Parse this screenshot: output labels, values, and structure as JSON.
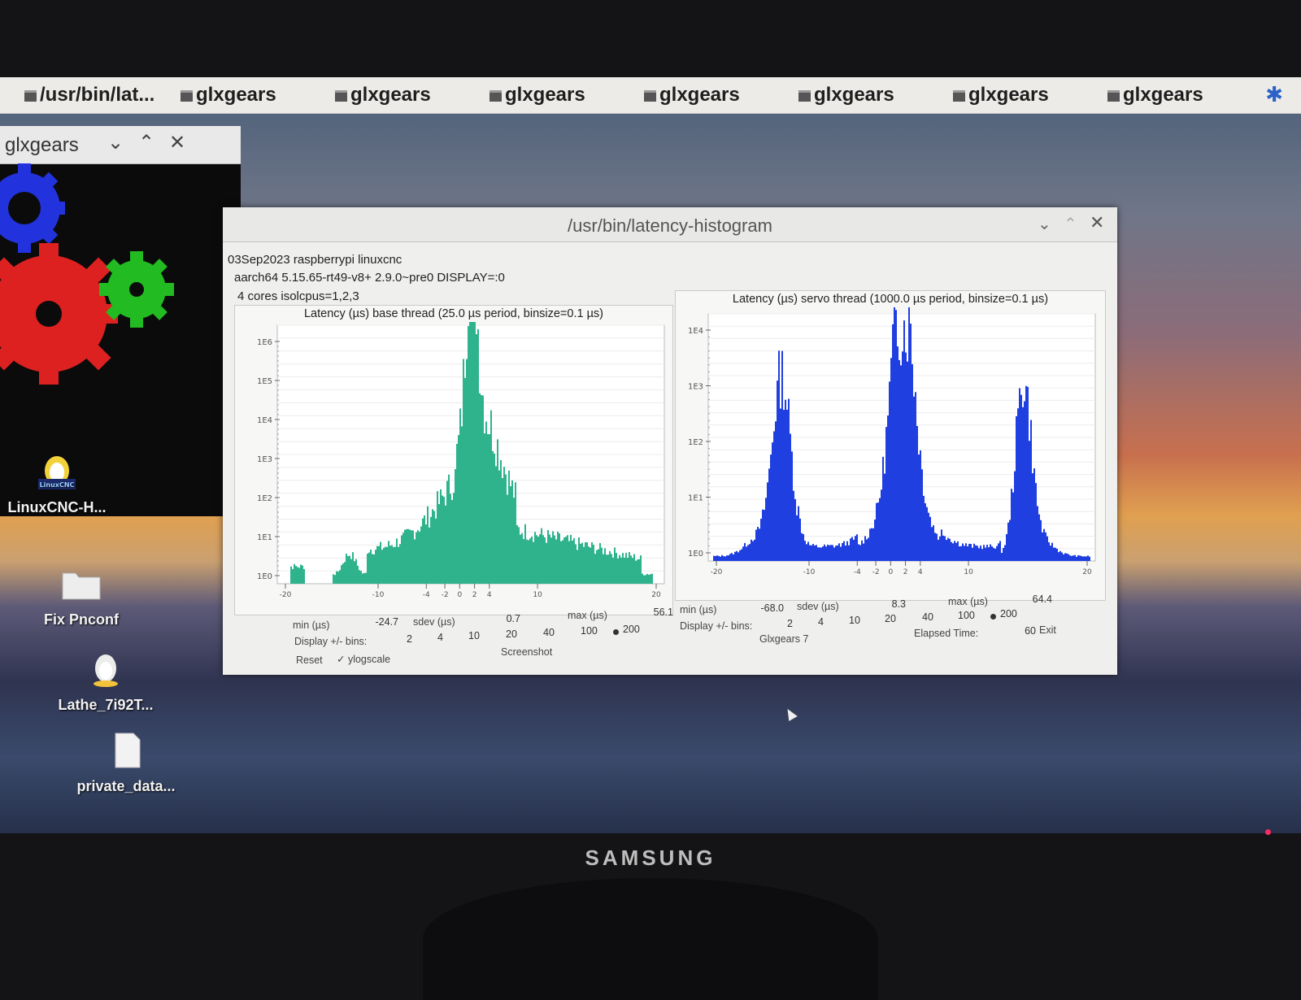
{
  "taskbar": {
    "items": [
      "/usr/bin/lat...",
      "glxgears",
      "glxgears",
      "glxgears",
      "glxgears",
      "glxgears",
      "glxgears",
      "glxgears"
    ],
    "bluetooth_icon": "bluetooth-icon"
  },
  "gears_window": {
    "title": "glxgears",
    "gear_colors": [
      "#2233dd",
      "#dd2020",
      "#22bb22"
    ]
  },
  "desktop_icons": [
    {
      "label": "LinuxCNC-H...",
      "badge": "LinuxCNC",
      "icon": "linuxcnc-icon"
    },
    {
      "label": "Fix Pnconf",
      "icon": "folder-icon"
    },
    {
      "label": "Lathe_7i92T...",
      "icon": "linuxcnc-icon"
    },
    {
      "label": "private_data...",
      "icon": "file-icon"
    }
  ],
  "histogram_window": {
    "title": "/usr/bin/latency-histogram",
    "info_lines": [
      "03Sep2023 raspberrypi linuxcnc",
      "aarch64  5.15.65-rt49-v8+  2.9.0~pre0  DISPLAY=:0",
      "4 cores  isolcpus=1,2,3"
    ],
    "base": {
      "title": "Latency (µs) base thread (25.0 µs period, binsize=0.1 µs)",
      "y_ticks": [
        "1E6",
        "1E5",
        "1E4",
        "1E3",
        "1E2",
        "1E1",
        "1E0"
      ],
      "x_ticks": [
        "-20",
        "-10",
        "-4",
        "-2",
        "0",
        "2",
        "4",
        "10",
        "20"
      ],
      "min_label": "min (µs)",
      "min_value": "-24.7",
      "sdev_label": "sdev (µs)",
      "sdev_value": "0.7",
      "max_label": "max (µs)",
      "max_value": "56.1",
      "bins_label": "Display +/- bins:",
      "bins": [
        "2",
        "4",
        "10",
        "20",
        "40",
        "100",
        "200"
      ]
    },
    "servo": {
      "title": "Latency (µs) servo thread (1000.0 µs period, binsize=0.1 µs)",
      "y_ticks": [
        "1E4",
        "1E3",
        "1E2",
        "1E1",
        "1E0"
      ],
      "x_ticks": [
        "-20",
        "-10",
        "-4",
        "-2",
        "0",
        "2",
        "4",
        "10",
        "20"
      ],
      "min_label": "min (µs)",
      "min_value": "-68.0",
      "sdev_label": "sdev (µs)",
      "sdev_value": "8.3",
      "max_label": "max (µs)",
      "max_value": "64.4",
      "bins_label": "Display +/- bins:",
      "bins": [
        "2",
        "4",
        "10",
        "20",
        "40",
        "100",
        "200"
      ]
    },
    "buttons": {
      "reset": "Reset",
      "ylogscale": "ylogscale",
      "screenshot": "Screenshot",
      "glxgears": "Glxgears 7",
      "elapsed_label": "Elapsed Time:",
      "elapsed_value": "60",
      "exit": "Exit"
    }
  },
  "monitor": {
    "brand": "SAMSUNG"
  },
  "colors": {
    "base_bars": "#2fb38c",
    "servo_bars": "#1f3fe0",
    "taskbar": "#ecebe8"
  }
}
